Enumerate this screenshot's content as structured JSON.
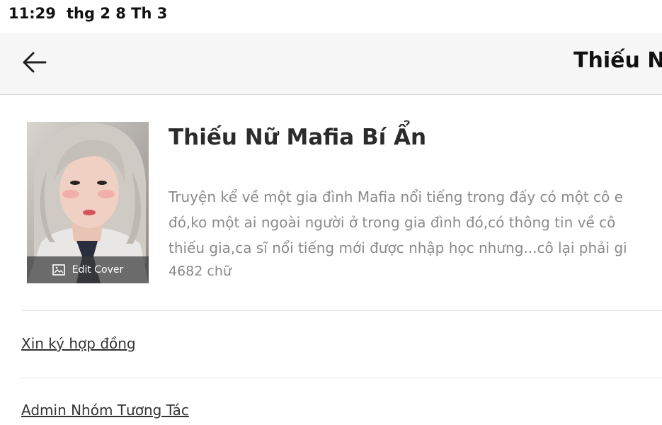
{
  "status_bar": {
    "time": "11:29",
    "date": "thg 2 8 Th 3"
  },
  "nav": {
    "back_icon": "arrow-left-icon",
    "title": "Thiếu Nữ"
  },
  "book": {
    "title": "Thiếu Nữ Mafia Bí Ẩn",
    "synopsis_lines": [
      "Truyện kể về một gia đình Mafia nổi tiếng trong đấy có một cô e",
      "đó,ko một ai ngoài người ở trong gia đình đó,có thông tin về cô",
      "thiếu gia,ca sĩ nổi tiếng mới được nhập học nhưng...cô lại phải gi"
    ],
    "word_count": "4682 chữ",
    "edit_cover_label": "Edit Cover",
    "edit_cover_icon": "image-icon"
  },
  "links": {
    "contract": "Xin ký hợp đồng",
    "admin_group": "Admin Nhóm Tương Tác"
  },
  "colors": {
    "nav_bg": "#f7f7f7",
    "text_muted": "#8a8a8a",
    "divider": "#e6e6e6"
  }
}
